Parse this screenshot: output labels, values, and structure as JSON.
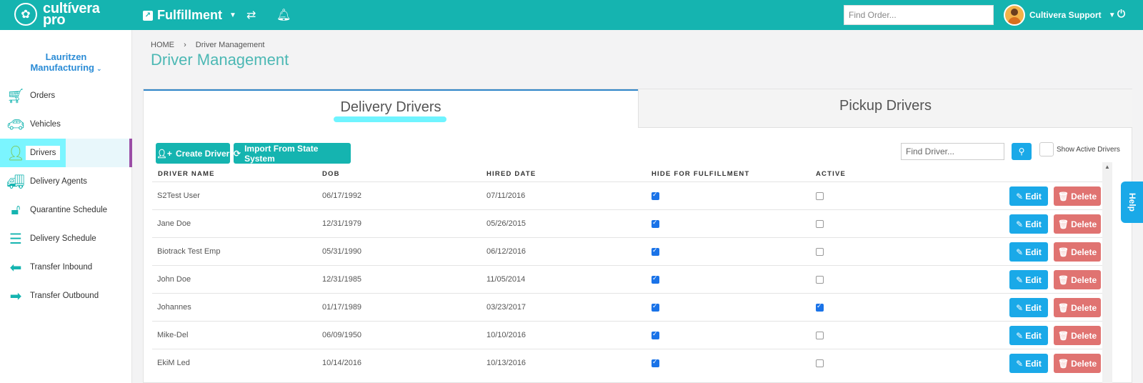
{
  "brand": {
    "line1": "cultívera",
    "line2": "pro"
  },
  "module": {
    "name": "Fulfillment"
  },
  "header": {
    "find_order_placeholder": "Find Order...",
    "user_name": "Cultivera Support"
  },
  "sidebar": {
    "company_line1": "Lauritzen",
    "company_line2": "Manufacturing",
    "items": [
      {
        "label": "Orders",
        "icon": "cart-icon"
      },
      {
        "label": "Vehicles",
        "icon": "car-icon"
      },
      {
        "label": "Drivers",
        "icon": "user-icon"
      },
      {
        "label": "Delivery Agents",
        "icon": "truck-icon"
      },
      {
        "label": "Quarantine Schedule",
        "icon": "unlock-icon"
      },
      {
        "label": "Delivery Schedule",
        "icon": "list-icon"
      },
      {
        "label": "Transfer Inbound",
        "icon": "arrow-left-icon"
      },
      {
        "label": "Transfer Outbound",
        "icon": "arrow-right-icon"
      }
    ]
  },
  "breadcrumb": {
    "home": "HOME",
    "current": "Driver Management"
  },
  "page": {
    "title": "Driver Management"
  },
  "tabs": [
    {
      "label": "Delivery Drivers"
    },
    {
      "label": "Pickup Drivers"
    }
  ],
  "toolbar": {
    "create_label": "Create Driver",
    "import_label": "Import From State System",
    "find_placeholder": "Find Driver...",
    "show_active_label": "Show Active Drivers"
  },
  "table": {
    "headers": [
      "DRIVER NAME",
      "DOB",
      "HIRED DATE",
      "HIDE FOR FULFILLMENT",
      "ACTIVE"
    ],
    "edit_label": "Edit",
    "delete_label": "Delete",
    "rows": [
      {
        "name": "S2Test User",
        "dob": "06/17/1992",
        "hired": "07/11/2016",
        "hide": true,
        "active": false
      },
      {
        "name": "Jane Doe",
        "dob": "12/31/1979",
        "hired": "05/26/2015",
        "hide": true,
        "active": false
      },
      {
        "name": "Biotrack Test Emp",
        "dob": "05/31/1990",
        "hired": "06/12/2016",
        "hide": true,
        "active": false
      },
      {
        "name": "John Doe",
        "dob": "12/31/1985",
        "hired": "11/05/2014",
        "hide": true,
        "active": false
      },
      {
        "name": "Johannes",
        "dob": "01/17/1989",
        "hired": "03/23/2017",
        "hide": true,
        "active": true
      },
      {
        "name": "Mike-Del",
        "dob": "06/09/1950",
        "hired": "10/10/2016",
        "hide": true,
        "active": false
      },
      {
        "name": "EkiM Led",
        "dob": "10/14/2016",
        "hired": "10/13/2016",
        "hide": true,
        "active": false
      }
    ]
  },
  "help": {
    "label": "Help"
  }
}
